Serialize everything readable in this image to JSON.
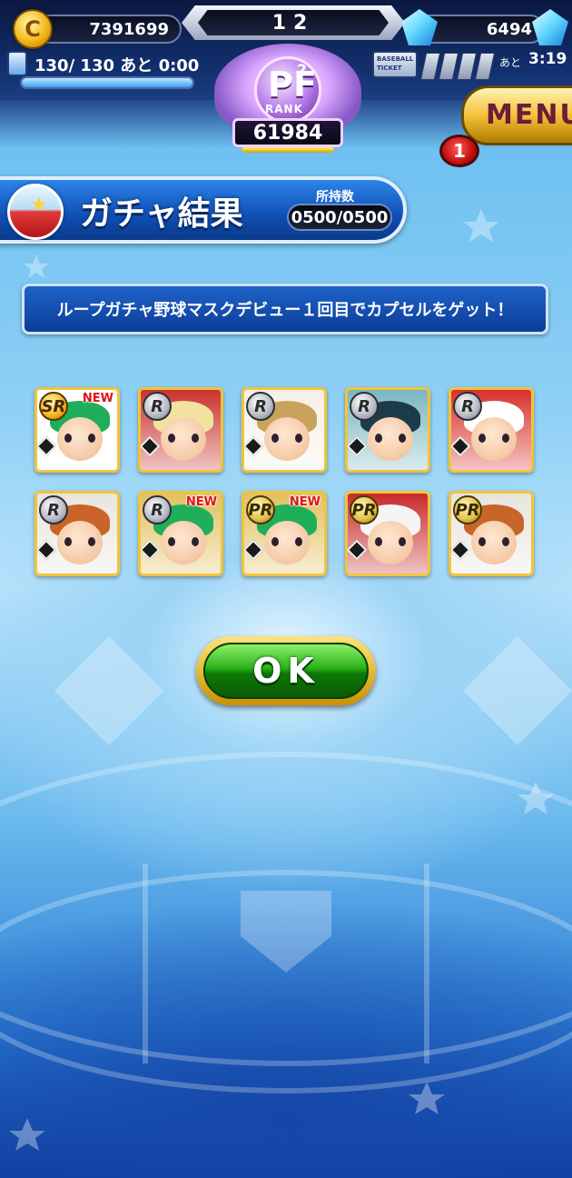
{
  "status_bar": {
    "coins": "7391699",
    "level": "12",
    "gems": "6494",
    "stamina": "130/ 130",
    "stamina_recovery_label": "あと",
    "stamina_recovery_time": "0:00",
    "stamina_fill_fraction": 1.0,
    "ticket_label": "BASEBALL TICKET",
    "ticket_timer_label": "あと",
    "ticket_timer": "3:19"
  },
  "rank": {
    "letters": "PF",
    "superscript": "2",
    "word": "RANK",
    "value": "61984"
  },
  "menu": {
    "label": "MENU",
    "badge_count": "1"
  },
  "result_header": {
    "title": "ガチャ結果",
    "owned_label": "所持数",
    "owned_value": "0500/0500"
  },
  "message": "ループガチャ野球マスクデビュー１回目でカプセルをゲット！",
  "cards": [
    {
      "rarity": "SR",
      "new": true,
      "new_label": "NEW",
      "hair_color": "#1fae5a",
      "bg": "#ffffff"
    },
    {
      "rarity": "R",
      "new": false,
      "new_label": "",
      "hair_color": "#f2e2a0",
      "bg": "#c9322e"
    },
    {
      "rarity": "R",
      "new": false,
      "new_label": "",
      "hair_color": "#c9a35a",
      "bg": "#f6f0e6"
    },
    {
      "rarity": "R",
      "new": false,
      "new_label": "",
      "hair_color": "#1e3b4a",
      "bg": "#7bb7c0"
    },
    {
      "rarity": "R",
      "new": false,
      "new_label": "",
      "hair_color": "#ffffff",
      "bg": "#d9302c"
    },
    {
      "rarity": "R",
      "new": false,
      "new_label": "",
      "hair_color": "#c9652a",
      "bg": "#e9e4de"
    },
    {
      "rarity": "R",
      "new": true,
      "new_label": "NEW",
      "hair_color": "#1fae5a",
      "bg": "#e2c060"
    },
    {
      "rarity": "PR",
      "new": true,
      "new_label": "NEW",
      "hair_color": "#1fae5a",
      "bg": "#e2c060"
    },
    {
      "rarity": "PR",
      "new": false,
      "new_label": "",
      "hair_color": "#f5f5f5",
      "bg": "#c82a2a"
    },
    {
      "rarity": "PR",
      "new": false,
      "new_label": "",
      "hair_color": "#c9652a",
      "bg": "#e9e4de"
    }
  ],
  "ok_button": {
    "label": "OK"
  },
  "colors": {
    "header_blue": "#0f4fb5",
    "ok_green": "#2bb21a",
    "gold_frame": "#f0c43b",
    "new_red": "#e0121a"
  }
}
